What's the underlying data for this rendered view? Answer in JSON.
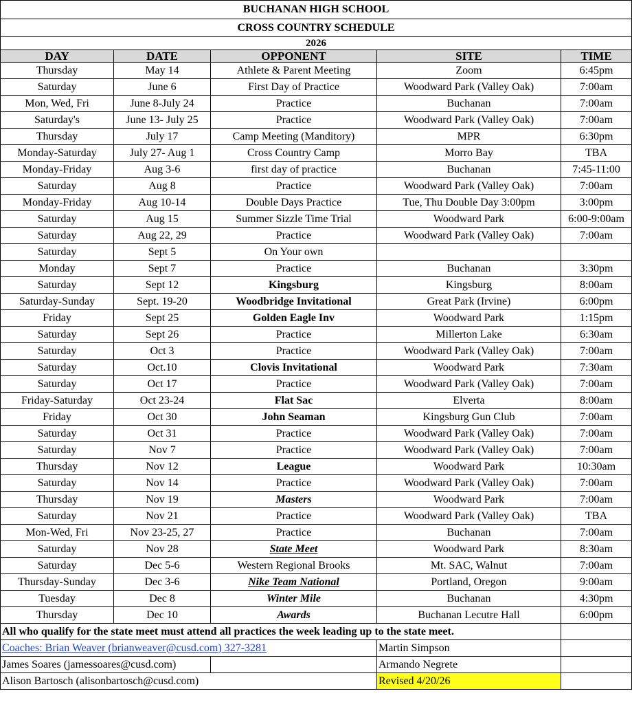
{
  "header": {
    "school": "BUCHANAN HIGH SCHOOL",
    "title": "CROSS COUNTRY SCHEDULE",
    "year": "2026"
  },
  "columns": {
    "day": "DAY",
    "date": "DATE",
    "opponent": "OPPONENT",
    "site": "SITE",
    "time": "TIME"
  },
  "rows": [
    {
      "day": "Thursday",
      "date": "May 14",
      "opponent": "Athlete & Parent Meeting",
      "site": "Zoom",
      "time": "6:45pm",
      "style": ""
    },
    {
      "day": "Saturday",
      "date": "June 6",
      "opponent": "First Day of Practice",
      "site": "Woodward Park (Valley Oak)",
      "time": "7:00am",
      "style": ""
    },
    {
      "day": "Mon, Wed, Fri",
      "date": "June 8-July 24",
      "opponent": "Practice",
      "site": "Buchanan",
      "time": "7:00am",
      "style": ""
    },
    {
      "day": "Saturday's",
      "date": "June 13- July 25",
      "opponent": "Practice",
      "site": "Woodward Park (Valley Oak)",
      "time": "7:00am",
      "style": ""
    },
    {
      "day": "Thursday",
      "date": "July 17",
      "opponent": "Camp Meeting (Manditory)",
      "site": "MPR",
      "time": "6:30pm",
      "style": ""
    },
    {
      "day": "Monday-Saturday",
      "date": "July 27- Aug 1",
      "opponent": "Cross Country Camp",
      "site": "Morro Bay",
      "time": "TBA",
      "style": ""
    },
    {
      "day": "Monday-Friday",
      "date": "Aug 3-6",
      "opponent": "first day of practice",
      "site": "Buchanan",
      "time": "7:45-11:00",
      "style": ""
    },
    {
      "day": "Saturday",
      "date": "Aug 8",
      "opponent": "Practice",
      "site": "Woodward Park (Valley Oak)",
      "time": "7:00am",
      "style": ""
    },
    {
      "day": "Monday-Friday",
      "date": "Aug 10-14",
      "opponent": "Double Days Practice",
      "site": "Tue, Thu Double Day 3:00pm",
      "time": "3:00pm",
      "style": ""
    },
    {
      "day": "Saturday",
      "date": "Aug 15",
      "opponent": "Summer Sizzle Time Trial",
      "site": "Woodward Park",
      "time": "6:00-9:00am",
      "style": ""
    },
    {
      "day": "Saturday",
      "date": "Aug 22, 29",
      "opponent": "Practice",
      "site": "Woodward Park (Valley Oak)",
      "time": "7:00am",
      "style": ""
    },
    {
      "day": "Saturday",
      "date": "Sept 5",
      "opponent": "On Your own",
      "site": "",
      "time": "",
      "style": ""
    },
    {
      "day": "Monday",
      "date": "Sept 7",
      "opponent": "Practice",
      "site": "Buchanan",
      "time": "3:30pm",
      "style": ""
    },
    {
      "day": "Saturday",
      "date": "Sept 12",
      "opponent": "Kingsburg",
      "site": "Kingsburg",
      "time": "8:00am",
      "style": "bold"
    },
    {
      "day": "Saturday-Sunday",
      "date": "Sept. 19-20",
      "opponent": "Woodbridge Invitational",
      "site": "Great Park (Irvine)",
      "time": "6:00pm",
      "style": "bold"
    },
    {
      "day": "Friday",
      "date": "Sept 25",
      "opponent": "Golden Eagle Inv",
      "site": "Woodward Park",
      "time": "1:15pm",
      "style": "bold"
    },
    {
      "day": "Saturday",
      "date": "Sept 26",
      "opponent": "Practice",
      "site": "Millerton Lake",
      "time": "6:30am",
      "style": ""
    },
    {
      "day": "Saturday",
      "date": "Oct 3",
      "opponent": "Practice",
      "site": "Woodward Park (Valley Oak)",
      "time": "7:00am",
      "style": ""
    },
    {
      "day": "Saturday",
      "date": "Oct.10",
      "opponent": "Clovis Invitational",
      "site": "Woodward Park",
      "time": "7:30am",
      "style": "bold"
    },
    {
      "day": "Saturday",
      "date": "Oct 17",
      "opponent": "Practice",
      "site": "Woodward Park (Valley Oak)",
      "time": "7:00am",
      "style": ""
    },
    {
      "day": "Friday-Saturday",
      "date": "Oct 23-24",
      "opponent": "Flat Sac",
      "site": "Elverta",
      "time": "8:00am",
      "style": "bold"
    },
    {
      "day": "Friday",
      "date": "Oct 30",
      "opponent": "John Seaman",
      "site": "Kingsburg Gun Club",
      "time": "7:00am",
      "style": "bold"
    },
    {
      "day": "Saturday",
      "date": "Oct 31",
      "opponent": "Practice",
      "site": "Woodward Park (Valley Oak)",
      "time": "7:00am",
      "style": ""
    },
    {
      "day": "Saturday",
      "date": "Nov 7",
      "opponent": "Practice",
      "site": "Woodward Park (Valley Oak)",
      "time": "7:00am",
      "style": ""
    },
    {
      "day": "Thursday",
      "date": "Nov 12",
      "opponent": "League",
      "site": "Woodward Park",
      "time": "10:30am",
      "style": "bold"
    },
    {
      "day": "Saturday",
      "date": "Nov 14",
      "opponent": "Practice",
      "site": "Woodward Park (Valley Oak)",
      "time": "7:00am",
      "style": ""
    },
    {
      "day": "Thursday",
      "date": "Nov 19",
      "opponent": "Masters",
      "site": "Woodward Park",
      "time": "7:00am",
      "style": "bi"
    },
    {
      "day": "Saturday",
      "date": "Nov 21",
      "opponent": "Practice",
      "site": "Woodward Park (Valley Oak)",
      "time": "TBA",
      "style": ""
    },
    {
      "day": "Mon-Wed, Fri",
      "date": "Nov 23-25, 27",
      "opponent": "Practice",
      "site": "Buchanan",
      "time": "7:00am",
      "style": ""
    },
    {
      "day": "Saturday",
      "date": "Nov 28",
      "opponent": "State Meet",
      "site": "Woodward Park",
      "time": "8:30am",
      "style": "biu"
    },
    {
      "day": "Saturday",
      "date": "Dec 5-6",
      "opponent": "Western Regional Brooks",
      "site": "Mt. SAC, Walnut",
      "time": "7:00am",
      "style": ""
    },
    {
      "day": "Thursday-Sunday",
      "date": "Dec 3-6",
      "opponent": "Nike Team National ",
      "site": "Portland, Oregon",
      "time": "9:00am",
      "style": "biu"
    },
    {
      "day": "Tuesday",
      "date": "Dec 8",
      "opponent": "Winter Mile",
      "site": "Buchanan",
      "time": "4:30pm",
      "style": "bi"
    },
    {
      "day": "Thursday",
      "date": "Dec 10",
      "opponent": "Awards",
      "site": "Buchanan Lecutre Hall",
      "time": "6:00pm",
      "style": "bi"
    }
  ],
  "note": "All who qualify for the state meet must attend all practices the week leading up to the state meet. ",
  "footer": {
    "coaches": "Coaches: Brian Weaver (brianweaver@cusd.com) 327-3281",
    "soares": " James Soares (jamessoares@cusd.com)",
    "bartosch": "Alison Bartosch (alisonbartosch@cusd.com)",
    "simpson": "Martin Simpson",
    "negrete": "Armando Negrete",
    "revised": "Revised 4/20/26",
    "revised_color": "#ffff1a"
  },
  "colors": {
    "header_fill": "#d9d9d9",
    "link": "#1a3fd6"
  }
}
